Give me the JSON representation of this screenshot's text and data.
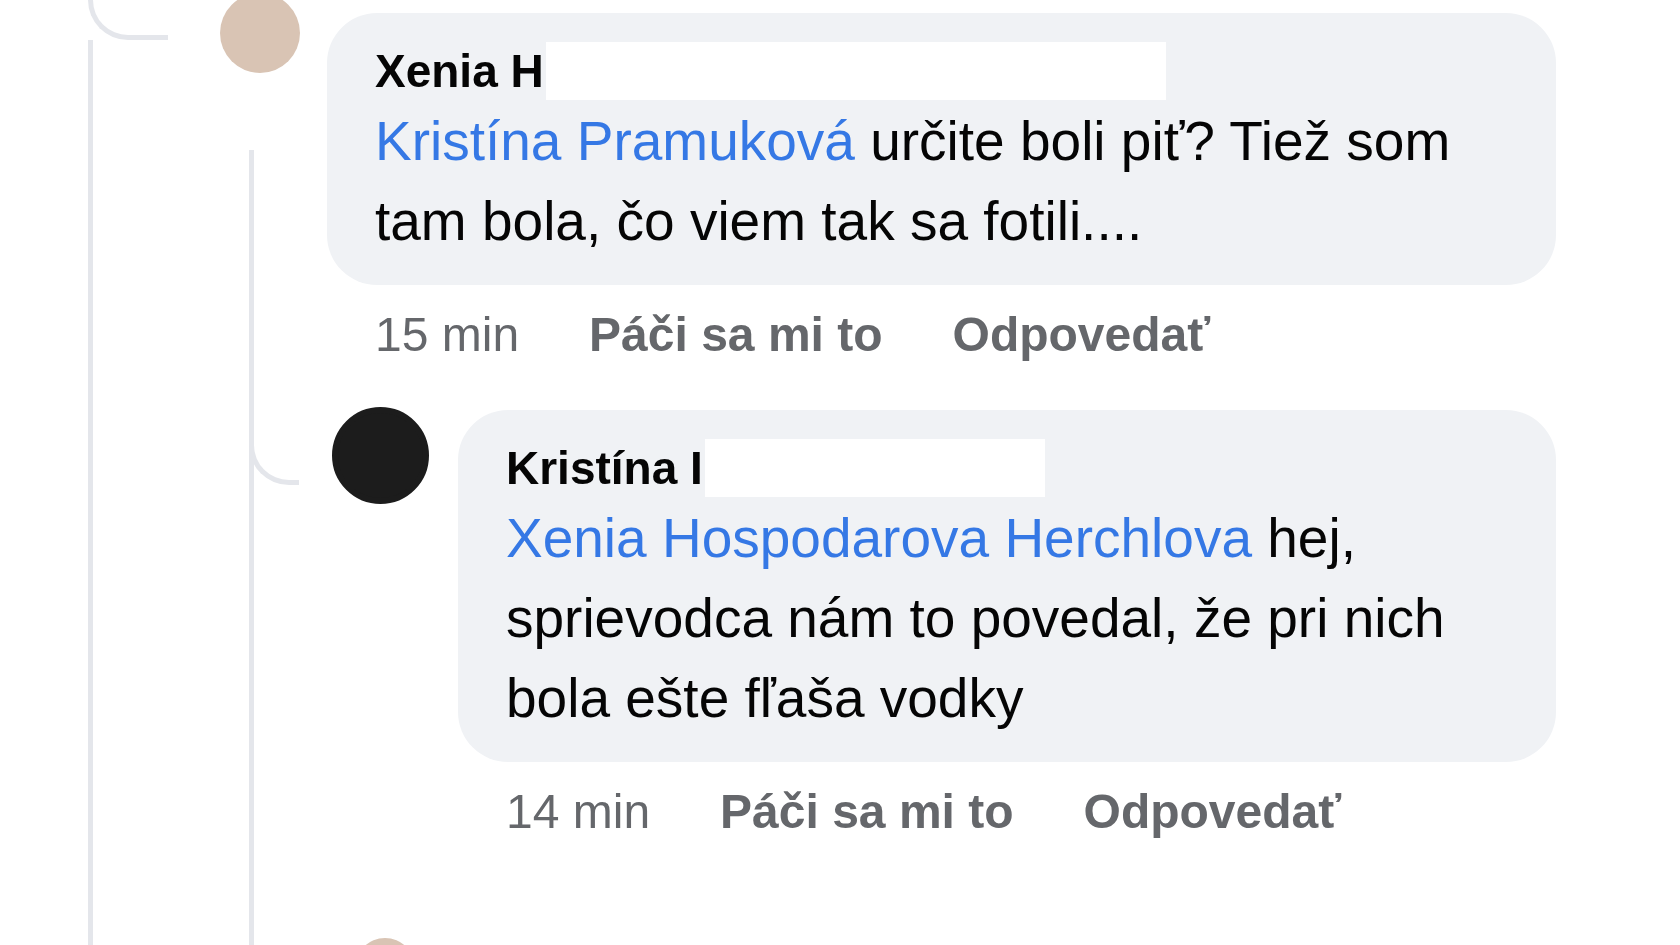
{
  "comments": [
    {
      "kind": "comment",
      "author": "Xenia H",
      "mention": "Kristína Pramuková",
      "text": "určite boli piť? Tiež som tam bola, čo viem tak sa fotili....",
      "time": "15 min",
      "actions": [
        "Páči sa mi to",
        "Odpovedať"
      ]
    },
    {
      "kind": "reply",
      "author": "Kristína I",
      "mention": "Xenia Hospodarova Herchlova",
      "text": "hej, sprievodca nám to povedal, že pri nich bola ešte fľaša vodky",
      "time": "14 min",
      "actions": [
        "Páči sa mi to",
        "Odpovedať"
      ]
    }
  ]
}
